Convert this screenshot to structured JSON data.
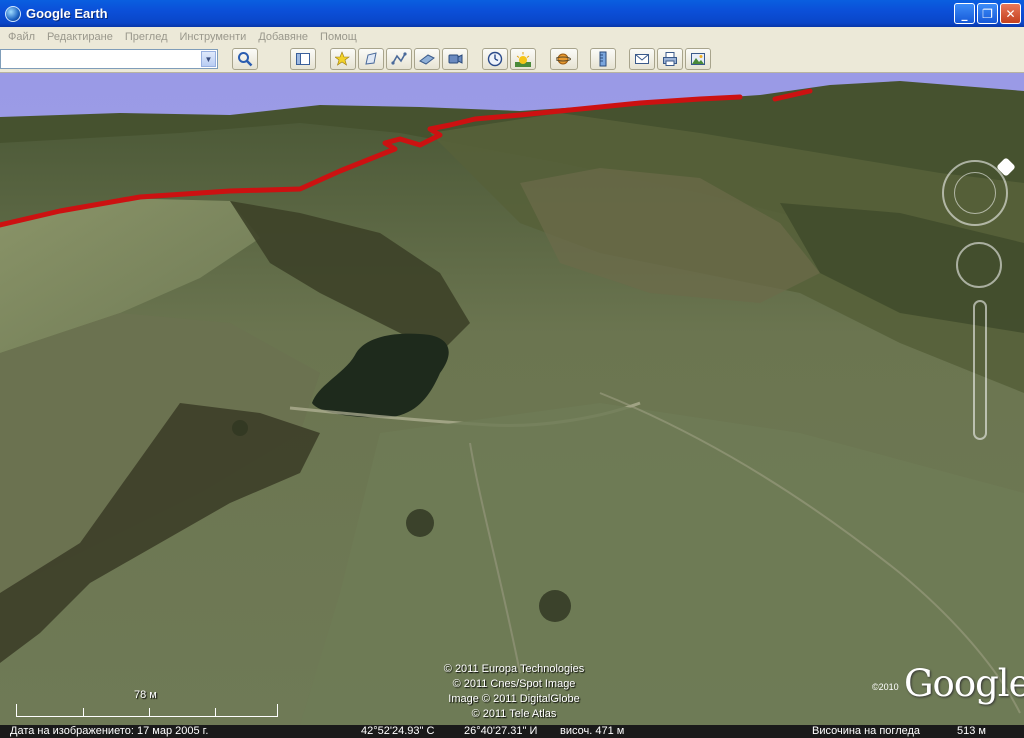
{
  "window": {
    "title": "Google Earth"
  },
  "menu": [
    "Файл",
    "Редактиране",
    "Преглед",
    "Инструменти",
    "Добавяне",
    "Помощ"
  ],
  "toolbar": {
    "search_value": "",
    "buttons": [
      "sidebar-toggle-icon",
      "add-placemark-icon",
      "add-polygon-icon",
      "add-path-icon",
      "add-image-overlay-icon",
      "record-tour-icon",
      "historical-imagery-icon",
      "sunlight-icon",
      "switch-planet-icon",
      "ruler-icon",
      "email-icon",
      "print-icon",
      "save-image-icon"
    ]
  },
  "map": {
    "path_color": "#cc1111",
    "copyright": [
      "© 2011 Europa Technologies",
      "© 2011 Cnes/Spot Image",
      "Image © 2011 DigitalGlobe",
      "© 2011 Tele Atlas"
    ],
    "logo_year": "©2010",
    "logo": "Google",
    "scale_label": "78 м"
  },
  "status": {
    "imagery_date": "Дата на изображението: 17 мар 2005 г.",
    "latitude": "42°52'24.93\" С",
    "longitude": "26°40'27.31\" И",
    "elevation": "височ.  471 м",
    "eye_alt_label": "Височина на погледа",
    "eye_alt_value": "513 м"
  }
}
